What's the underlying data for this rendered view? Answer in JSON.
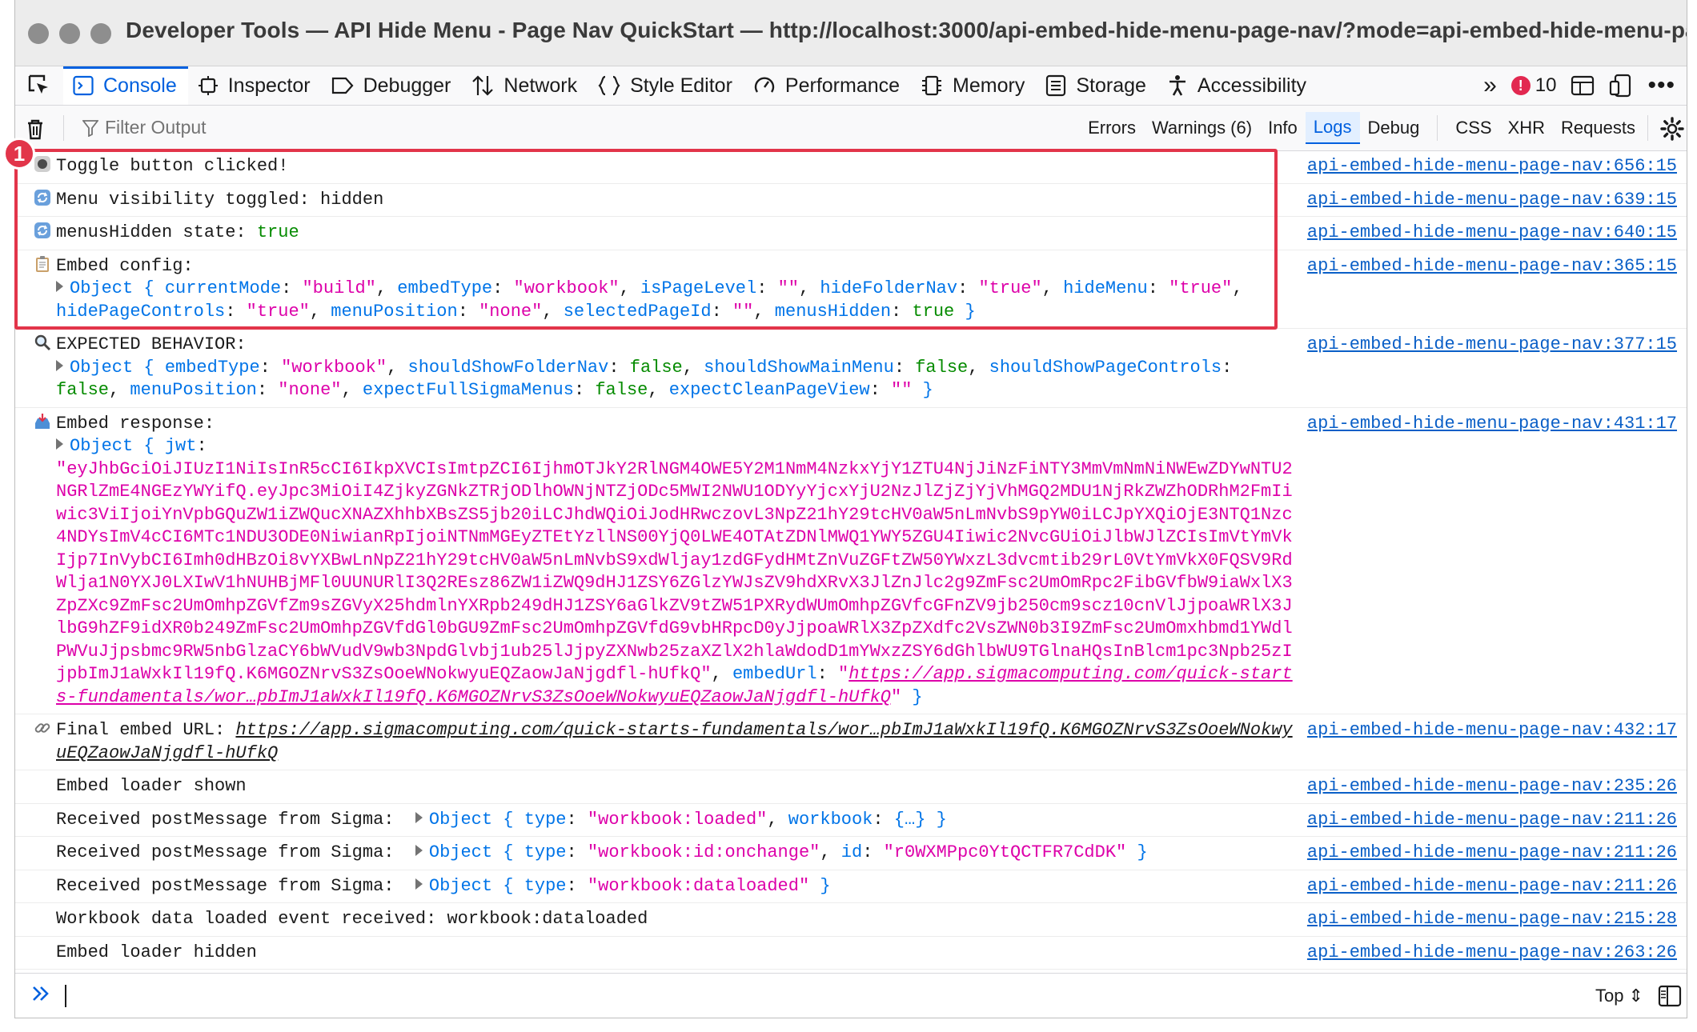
{
  "window": {
    "title": "Developer Tools — API Hide Menu - Page Nav QuickStart — http://localhost:3000/api-embed-hide-menu-page-nav/?mode=api-embed-hide-menu-page-..."
  },
  "toolbar": {
    "tabs": [
      {
        "label": "Console",
        "icon": "console-icon",
        "selected": true
      },
      {
        "label": "Inspector",
        "icon": "inspector-icon"
      },
      {
        "label": "Debugger",
        "icon": "debugger-icon"
      },
      {
        "label": "Network",
        "icon": "network-icon"
      },
      {
        "label": "Style Editor",
        "icon": "style-editor-icon"
      },
      {
        "label": "Performance",
        "icon": "performance-icon"
      },
      {
        "label": "Memory",
        "icon": "memory-icon"
      },
      {
        "label": "Storage",
        "icon": "storage-icon"
      },
      {
        "label": "Accessibility",
        "icon": "accessibility-icon"
      }
    ],
    "error_count": "10"
  },
  "filterbar": {
    "placeholder": "Filter Output",
    "levels": [
      "Errors",
      "Warnings (6)",
      "Info",
      "Logs",
      "Debug"
    ],
    "active_level": "Logs",
    "types": [
      "CSS",
      "XHR",
      "Requests"
    ]
  },
  "annotation": {
    "badge": "1"
  },
  "messages": [
    {
      "icon": "record-emoji",
      "parts": [
        {
          "t": "Toggle button clicked!"
        }
      ],
      "source": "api-embed-hide-menu-page-nav:656:15"
    },
    {
      "icon": "arrows-emoji",
      "parts": [
        {
          "t": "Menu visibility toggled: hidden"
        }
      ],
      "source": "api-embed-hide-menu-page-nav:639:15"
    },
    {
      "icon": "arrows-emoji",
      "parts": [
        {
          "t": "menusHidden state: "
        },
        {
          "t": "true",
          "c": "g"
        }
      ],
      "source": "api-embed-hide-menu-page-nav:640:15"
    },
    {
      "icon": "clipboard-emoji",
      "parts": [
        {
          "t": "Embed config:\n"
        },
        {
          "tw": true
        },
        {
          "t": "Object { ",
          "c": "ol"
        },
        {
          "t": "currentMode",
          "c": "k"
        },
        {
          "t": ": "
        },
        {
          "t": "\"build\"",
          "c": "s"
        },
        {
          "t": ", "
        },
        {
          "t": "embedType",
          "c": "k"
        },
        {
          "t": ": "
        },
        {
          "t": "\"workbook\"",
          "c": "s"
        },
        {
          "t": ", "
        },
        {
          "t": "isPageLevel",
          "c": "k"
        },
        {
          "t": ": "
        },
        {
          "t": "\"\"",
          "c": "s"
        },
        {
          "t": ", "
        },
        {
          "t": "hideFolderNav",
          "c": "k"
        },
        {
          "t": ": "
        },
        {
          "t": "\"true\"",
          "c": "s"
        },
        {
          "t": ", "
        },
        {
          "t": "hideMenu",
          "c": "k"
        },
        {
          "t": ": "
        },
        {
          "t": "\"true\"",
          "c": "s"
        },
        {
          "t": ",\n"
        },
        {
          "t": "hidePageControls",
          "c": "k"
        },
        {
          "t": ": "
        },
        {
          "t": "\"true\"",
          "c": "s"
        },
        {
          "t": ", "
        },
        {
          "t": "menuPosition",
          "c": "k"
        },
        {
          "t": ": "
        },
        {
          "t": "\"none\"",
          "c": "s"
        },
        {
          "t": ", "
        },
        {
          "t": "selectedPageId",
          "c": "k"
        },
        {
          "t": ": "
        },
        {
          "t": "\"\"",
          "c": "s"
        },
        {
          "t": ", "
        },
        {
          "t": "menusHidden",
          "c": "k"
        },
        {
          "t": ": "
        },
        {
          "t": "true",
          "c": "g"
        },
        {
          "t": " }",
          "c": "ol"
        }
      ],
      "source": "api-embed-hide-menu-page-nav:365:15"
    },
    {
      "icon": "magnifier-emoji",
      "parts": [
        {
          "t": "EXPECTED BEHAVIOR:\n"
        },
        {
          "tw": true
        },
        {
          "t": "Object { ",
          "c": "ol"
        },
        {
          "t": "embedType",
          "c": "k"
        },
        {
          "t": ": "
        },
        {
          "t": "\"workbook\"",
          "c": "s"
        },
        {
          "t": ", "
        },
        {
          "t": "shouldShowFolderNav",
          "c": "k"
        },
        {
          "t": ": "
        },
        {
          "t": "false",
          "c": "g"
        },
        {
          "t": ", "
        },
        {
          "t": "shouldShowMainMenu",
          "c": "k"
        },
        {
          "t": ": "
        },
        {
          "t": "false",
          "c": "g"
        },
        {
          "t": ", "
        },
        {
          "t": "shouldShowPageControls",
          "c": "k"
        },
        {
          "t": ":\n"
        },
        {
          "t": "false",
          "c": "g"
        },
        {
          "t": ", "
        },
        {
          "t": "menuPosition",
          "c": "k"
        },
        {
          "t": ": "
        },
        {
          "t": "\"none\"",
          "c": "s"
        },
        {
          "t": ", "
        },
        {
          "t": "expectFullSigmaMenus",
          "c": "k"
        },
        {
          "t": ": "
        },
        {
          "t": "false",
          "c": "g"
        },
        {
          "t": ", "
        },
        {
          "t": "expectCleanPageView",
          "c": "k"
        },
        {
          "t": ": "
        },
        {
          "t": "\"\"",
          "c": "s"
        },
        {
          "t": " }",
          "c": "ol"
        }
      ],
      "source": "api-embed-hide-menu-page-nav:377:15"
    },
    {
      "icon": "inbox-emoji",
      "parts": [
        {
          "t": "Embed response:\n"
        },
        {
          "tw": true
        },
        {
          "t": "Object { ",
          "c": "ol"
        },
        {
          "t": "jwt",
          "c": "k"
        },
        {
          "t": ":\n"
        },
        {
          "t": "\"eyJhbGciOiJIUzI1NiIsInR5cCI6IkpXVCIsImtpZCI6IjhmOTJkY2RlNGM4OWE5Y2M1NmM4NzkxYjY1ZTU4NjJiNzFiNTY3MmVmNmNiNWEwZDYwNTU2NGRlZmE4NGEzYWYifQ.eyJpc3MiOiI4ZjkyZGNkZTRjODlhOWNjNTZjODc5MWI2NWU1ODYyYjcxYjU2NzJlZjZjYjVhMGQ2MDU1NjRkZWZhODRhM2FmIiwic3ViIjoiYnVpbGQuZW1iZWQucXNAZXhhbXBsZS5jb20iLCJhdWQiOiJodHRwczovL3NpZ21hY29tcHV0aW5nLmNvbS9pYW0iLCJpYXQiOjE3NTQ1Nzc4NDYsImV4cCI6MTc1NDU3ODE0NiwianRpIjoiNTNmMGEyZTEtYzllNS00YjQ0LWE4OTAtZDNlMWQ1YWY5ZGU4Iiwic2NvcGUiOiJlbWJlZCIsImVtYmVkIjp7InVybCI6Imh0dHBzOi8vYXBwLnNpZ21hY29tcHV0aW5nLmNvbS9xdWljay1zdGFydHMtZnVuZGFtZW50YWxzL3dvcmtib29rL0VtYmVkX0FQSV9RdWlja1N0YXJ0LXIwV1hNUHBjMFl0UUNURlI3Q2REsz86ZW1iZWQ9dHJ1ZSY6ZGlzYWJsZV9hdXRvX3JlZnJlc2g9ZmFsc2UmOmRpc2FibGVfbW9iaWxlX3ZpZXc9ZmFsc2UmOmhpZGVfZm9sZGVyX25hdmlnYXRpb249dHJ1ZSY6aGlkZV9tZW51PXRydWUmOmhpZGVfcGFnZV9jb250cm9scz10cnVlJjpoaWRlX3JlbG9hZF9idXR0b249ZmFsc2UmOmhpZGVfdGl0bGU9ZmFsc2UmOmhpZGVfdG9vbHRpcD0yJjpoaWRlX3ZpZXdfc2VsZWN0b3I9ZmFsc2UmOmxhbmd1YWdlPWVuJjpsbmc9RW5nbGlzaCY6bWVudV9wb3NpdGlvbj1ub25lJjpyZXNwb25zaXZlX2hlaWdodD1mYWxzZSY6dGhlbWU9TGlnaHQsInBlcm1pc3Npb25zIjpbImJ1aWxkIl19fQ.K6MGOZNrvS3ZsOoeWNokwyuEQZaowJaNjgdfl-hUfkQ\"",
          "c": "s"
        },
        {
          "t": ", "
        },
        {
          "t": "embedUrl",
          "c": "k"
        },
        {
          "t": ": "
        },
        {
          "t": "\"",
          "c": "s"
        },
        {
          "t": "https://app.sigmacomputing.com/quick-starts-fundamentals/wor…pbImJ1aWxkIl19fQ.K6MGOZNrvS3ZsOoeWNokwyuEQZaowJaNjgdfl-hUfkQ",
          "c": "u"
        },
        {
          "t": "\"",
          "c": "s"
        },
        {
          "t": " }",
          "c": "ol"
        }
      ],
      "source": "api-embed-hide-menu-page-nav:431:17"
    },
    {
      "icon": "link-emoji",
      "parts": [
        {
          "t": "Final embed URL: "
        },
        {
          "t": "https://app.sigmacomputing.com/quick-starts-fundamentals/wor…pbImJ1aWxkIl19fQ.K6MGOZNrvS3ZsOoeWNokwyuEQZaowJaNjgdfl-hUfkQ",
          "c": "url"
        }
      ],
      "source": "api-embed-hide-menu-page-nav:432:17"
    },
    {
      "parts": [
        {
          "t": "Embed loader shown"
        }
      ],
      "source": "api-embed-hide-menu-page-nav:235:26"
    },
    {
      "parts": [
        {
          "t": "Received postMessage from Sigma:  "
        },
        {
          "tw": true
        },
        {
          "t": "Object { ",
          "c": "ol"
        },
        {
          "t": "type",
          "c": "k"
        },
        {
          "t": ": "
        },
        {
          "t": "\"workbook:loaded\"",
          "c": "s"
        },
        {
          "t": ", "
        },
        {
          "t": "workbook",
          "c": "k"
        },
        {
          "t": ": "
        },
        {
          "t": "{…}",
          "c": "ol"
        },
        {
          "t": " }",
          "c": "ol"
        }
      ],
      "source": "api-embed-hide-menu-page-nav:211:26"
    },
    {
      "parts": [
        {
          "t": "Received postMessage from Sigma:  "
        },
        {
          "tw": true
        },
        {
          "t": "Object { ",
          "c": "ol"
        },
        {
          "t": "type",
          "c": "k"
        },
        {
          "t": ": "
        },
        {
          "t": "\"workbook:id:onchange\"",
          "c": "s"
        },
        {
          "t": ", "
        },
        {
          "t": "id",
          "c": "k"
        },
        {
          "t": ": "
        },
        {
          "t": "\"r0WXMPpc0YtQCTFR7CdDK\"",
          "c": "s"
        },
        {
          "t": " }",
          "c": "ol"
        }
      ],
      "source": "api-embed-hide-menu-page-nav:211:26"
    },
    {
      "parts": [
        {
          "t": "Received postMessage from Sigma:  "
        },
        {
          "tw": true
        },
        {
          "t": "Object { ",
          "c": "ol"
        },
        {
          "t": "type",
          "c": "k"
        },
        {
          "t": ": "
        },
        {
          "t": "\"workbook:dataloaded\"",
          "c": "s"
        },
        {
          "t": " }",
          "c": "ol"
        }
      ],
      "source": "api-embed-hide-menu-page-nav:211:26"
    },
    {
      "parts": [
        {
          "t": "Workbook data loaded event received: workbook:dataloaded"
        }
      ],
      "source": "api-embed-hide-menu-page-nav:215:28"
    },
    {
      "parts": [
        {
          "t": "Embed loader hidden"
        }
      ],
      "source": "api-embed-hide-menu-page-nav:263:26"
    }
  ],
  "input": {
    "context": "Top ⇕"
  },
  "colors": {
    "accent": "#0060df",
    "highlight": "#e2354a",
    "string": "#dd00a9",
    "key": "#0074e8",
    "bool": "#058b00"
  }
}
